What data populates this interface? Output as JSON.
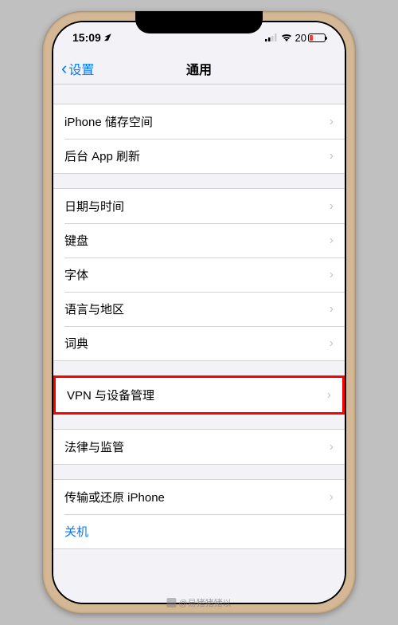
{
  "status": {
    "time": "15:09",
    "battery_pct": "20"
  },
  "nav": {
    "back_label": "设置",
    "title": "通用"
  },
  "groups": [
    {
      "rows": [
        {
          "label": "iPhone 储存空间",
          "chevron": true
        },
        {
          "label": "后台 App 刷新",
          "chevron": true
        }
      ]
    },
    {
      "rows": [
        {
          "label": "日期与时间",
          "chevron": true
        },
        {
          "label": "键盘",
          "chevron": true
        },
        {
          "label": "字体",
          "chevron": true
        },
        {
          "label": "语言与地区",
          "chevron": true
        },
        {
          "label": "词典",
          "chevron": true
        }
      ]
    },
    {
      "highlight": true,
      "rows": [
        {
          "label": "VPN 与设备管理",
          "chevron": true
        }
      ]
    },
    {
      "rows": [
        {
          "label": "法律与监管",
          "chevron": true
        }
      ]
    },
    {
      "rows": [
        {
          "label": "传输或还原 iPhone",
          "chevron": true
        },
        {
          "label": "关机",
          "chevron": false,
          "link": true
        }
      ]
    }
  ],
  "watermark": "@易猪猪猪以"
}
